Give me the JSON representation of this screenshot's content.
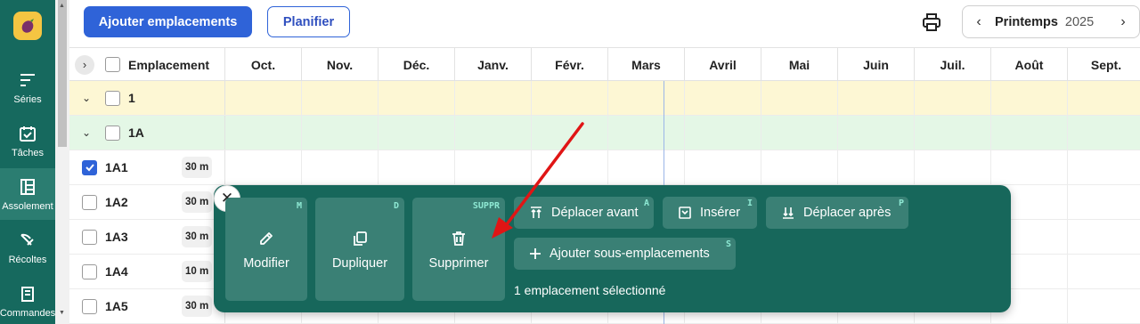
{
  "sidebar": {
    "items": [
      {
        "label": "Séries",
        "icon": "series-icon",
        "active": false
      },
      {
        "label": "Tâches",
        "icon": "calendar-check-icon",
        "active": false
      },
      {
        "label": "Assolement",
        "icon": "layout-icon",
        "active": true
      },
      {
        "label": "Récoltes",
        "icon": "harvest-icon",
        "active": false
      },
      {
        "label": "Commandes",
        "icon": "orders-icon",
        "active": false
      }
    ]
  },
  "toolbar": {
    "add_locations_label": "Ajouter emplacements",
    "plan_label": "Planifier",
    "season": {
      "prev": "‹",
      "name": "Printemps",
      "year": "2025",
      "next": "›"
    }
  },
  "grid": {
    "header": {
      "location_label": "Emplacement",
      "months": [
        "Oct.",
        "Nov.",
        "Déc.",
        "Janv.",
        "Févr.",
        "Mars",
        "Avril",
        "Mai",
        "Juin",
        "Juil.",
        "Août",
        "Sept."
      ]
    },
    "rows": [
      {
        "type": "bed",
        "name": "1",
        "checked": false
      },
      {
        "type": "sub",
        "name": "1A",
        "checked": false
      },
      {
        "type": "leaf",
        "name": "1A1",
        "length": "30 m",
        "checked": true
      },
      {
        "type": "leaf",
        "name": "1A2",
        "length": "30 m",
        "checked": false
      },
      {
        "type": "leaf",
        "name": "1A3",
        "length": "30 m",
        "checked": false
      },
      {
        "type": "leaf",
        "name": "1A4",
        "length": "10 m",
        "checked": false
      },
      {
        "type": "leaf",
        "name": "1A5",
        "length": "30 m",
        "checked": false
      }
    ]
  },
  "actions": {
    "close": "✕",
    "edit": {
      "label": "Modifier",
      "shortcut": "M"
    },
    "duplicate": {
      "label": "Dupliquer",
      "shortcut": "D"
    },
    "delete": {
      "label": "Supprimer",
      "shortcut": "SUPPR"
    },
    "move_before": {
      "label": "Déplacer avant",
      "shortcut": "A"
    },
    "insert": {
      "label": "Insérer",
      "shortcut": "I"
    },
    "move_after": {
      "label": "Déplacer après",
      "shortcut": "P"
    },
    "add_sub": {
      "label": "Ajouter sous-emplacements",
      "shortcut": "S"
    },
    "selection_text": "1 emplacement sélectionné"
  },
  "colors": {
    "sidebar": "#16695e",
    "primary": "#2f63d8",
    "panel": "#17675b",
    "panel_button": "#3a8075",
    "shortcut": "#8ee8d3",
    "bed_row": "#fdf7d4",
    "sub_row": "#e4f7e6",
    "annotation_arrow": "#e01515"
  }
}
